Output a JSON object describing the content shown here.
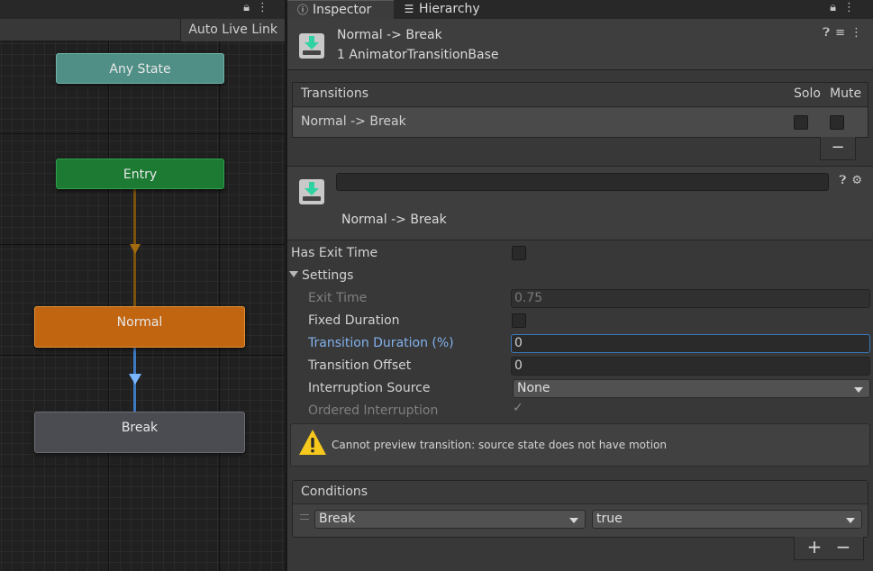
{
  "graph": {
    "auto_live_link": "Auto Live Link",
    "nodes": {
      "any_state": "Any State",
      "entry": "Entry",
      "normal": "Normal",
      "break": "Break"
    }
  },
  "tabs": {
    "inspector": "Inspector",
    "hierarchy": "Hierarchy"
  },
  "header": {
    "title": "Normal -> Break",
    "subtitle": "1 AnimatorTransitionBase"
  },
  "transitions": {
    "heading": "Transitions",
    "solo": "Solo",
    "mute": "Mute",
    "rows": [
      {
        "label": "Normal -> Break",
        "solo": false,
        "mute": false
      }
    ],
    "remove": "−"
  },
  "detail": {
    "name_value": "",
    "title": "Normal -> Break",
    "has_exit_time": {
      "label": "Has Exit Time",
      "checked": false
    },
    "settings_label": "Settings",
    "exit_time": {
      "label": "Exit Time",
      "value": "0.75"
    },
    "fixed_duration": {
      "label": "Fixed Duration",
      "checked": false
    },
    "transition_duration": {
      "label": "Transition Duration (%)",
      "value": "0"
    },
    "transition_offset": {
      "label": "Transition Offset",
      "value": "0"
    },
    "interruption_source": {
      "label": "Interruption Source",
      "value": "None"
    },
    "ordered_interruption": {
      "label": "Ordered Interruption",
      "checked": true
    },
    "warning": "Cannot preview transition: source state does not have motion"
  },
  "conditions": {
    "heading": "Conditions",
    "rows": [
      {
        "parameter": "Break",
        "value": "true"
      }
    ],
    "add": "+",
    "remove": "−"
  },
  "colors": {
    "any_state": "#4f8f86",
    "entry": "#1c7a33",
    "normal": "#c16511",
    "break": "#4a4c52",
    "accent": "#3a79bb"
  }
}
